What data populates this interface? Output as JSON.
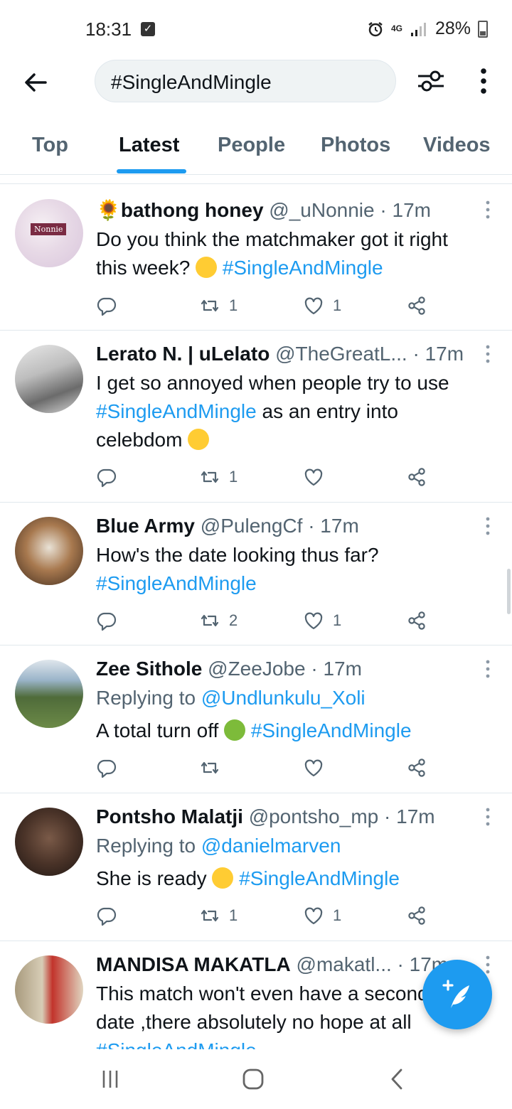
{
  "status_bar": {
    "time": "18:31",
    "network": "4G",
    "battery": "28%"
  },
  "search": {
    "query": "#SingleAndMingle"
  },
  "tabs": [
    {
      "label": "Top",
      "active": false
    },
    {
      "label": "Latest",
      "active": true
    },
    {
      "label": "People",
      "active": false
    },
    {
      "label": "Photos",
      "active": false
    },
    {
      "label": "Videos",
      "active": false
    }
  ],
  "tweets": [
    {
      "name": "🌻bathong honey",
      "handle": "@_uNonnie",
      "dot": "·",
      "time": "17m",
      "avatar_text": "Nonnie",
      "text_1": "Do you think the matchmaker got it right",
      "text_2": "this week?",
      "hashtag": "#SingleAndMingle",
      "retweets": "1",
      "likes": "1"
    },
    {
      "name": "Lerato N. | uLelato",
      "handle": "@TheGreatL...",
      "dot": "·",
      "time": "17m",
      "text_1": "I get so annoyed when people try to use",
      "hashtag": "#SingleAndMingle",
      "text_2": "as an entry into",
      "text_3": "celebdom",
      "retweets": "1",
      "likes": ""
    },
    {
      "name": "Blue Army",
      "handle": "@PulengCf",
      "dot": "·",
      "time": "17m",
      "text_1": "How's the date looking thus far?",
      "hashtag": "#SingleAndMingle",
      "retweets": "2",
      "likes": "1"
    },
    {
      "name": "Zee Sithole",
      "handle": "@ZeeJobe",
      "dot": "·",
      "time": "17m",
      "replying_label": "Replying to",
      "replying_to": "@Undlunkulu_Xoli",
      "text_1": "A total turn off",
      "hashtag": "#SingleAndMingle",
      "retweets": "",
      "likes": ""
    },
    {
      "name": "Pontsho Malatji",
      "handle": "@pontsho_mp",
      "dot": "·",
      "time": "17m",
      "replying_label": "Replying to",
      "replying_to": "@danielmarven",
      "text_1": "She is ready",
      "hashtag": "#SingleAndMingle",
      "retweets": "1",
      "likes": "1"
    },
    {
      "name": "MANDISA MAKATLA",
      "handle": "@makatl...",
      "dot": "·",
      "time": "17m",
      "text_1": "This match won't even have a second",
      "text_2": "date ,there absolutely no hope at all",
      "hashtag": "#SingleAndMingle"
    }
  ],
  "icons": {
    "back": "arrow-left-icon",
    "filter": "sliders-icon",
    "more": "vertical-dots-icon",
    "reply": "comment-icon",
    "retweet": "retweet-icon",
    "like": "heart-icon",
    "share": "share-icon",
    "compose": "feather-plus-icon"
  },
  "colors": {
    "accent": "#1d9bf0",
    "text": "#0f1419",
    "muted": "#536471"
  }
}
